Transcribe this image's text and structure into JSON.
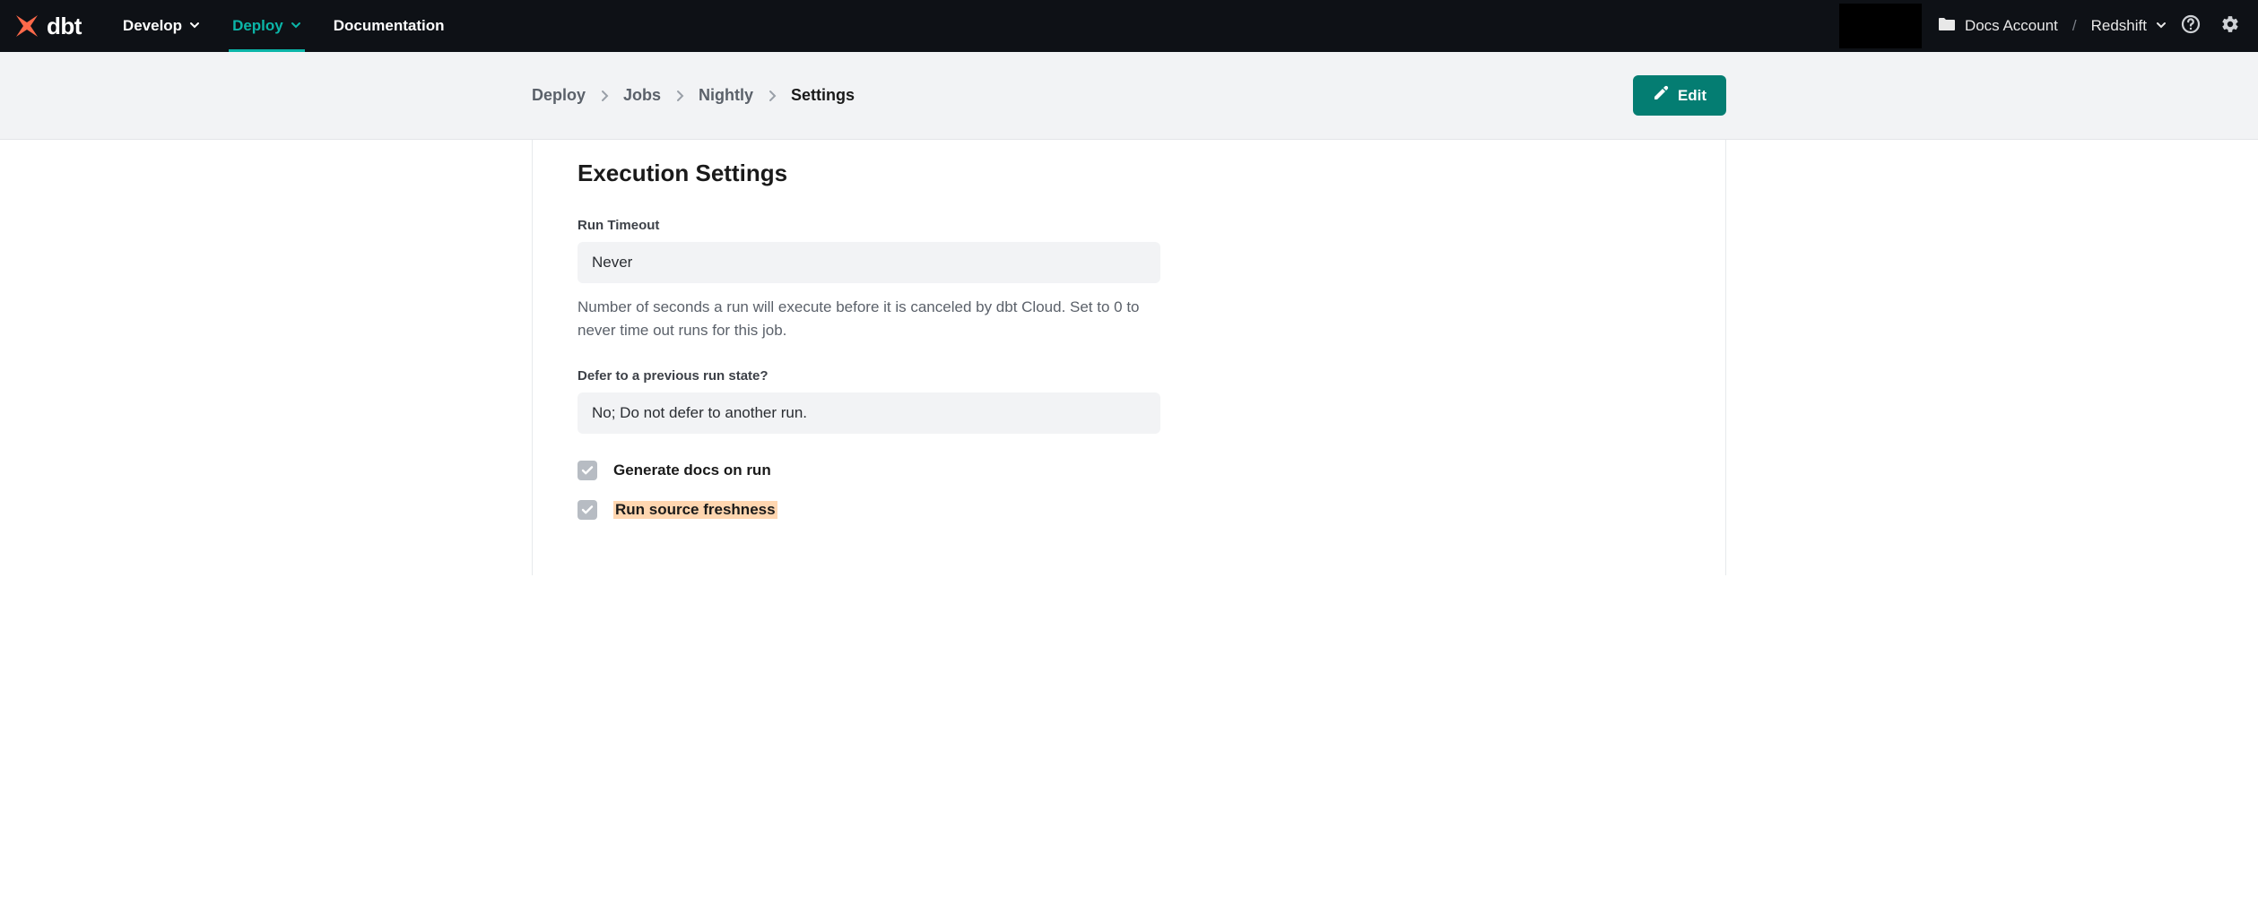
{
  "brand": {
    "name": "dbt"
  },
  "nav": {
    "develop": "Develop",
    "deploy": "Deploy",
    "documentation": "Documentation"
  },
  "account": {
    "name": "Docs Account",
    "project": "Redshift"
  },
  "breadcrumbs": {
    "deploy": "Deploy",
    "jobs": "Jobs",
    "job_name": "Nightly",
    "settings": "Settings"
  },
  "actions": {
    "edit": "Edit"
  },
  "section": {
    "title": "Execution Settings",
    "run_timeout": {
      "label": "Run Timeout",
      "value": "Never",
      "help": "Number of seconds a run will execute before it is canceled by dbt Cloud. Set to 0 to never time out runs for this job."
    },
    "defer": {
      "label": "Defer to a previous run state?",
      "value": "No; Do not defer to another run."
    },
    "gen_docs": {
      "label": "Generate docs on run",
      "checked": true
    },
    "source_freshness": {
      "label": "Run source freshness",
      "checked": true
    }
  }
}
